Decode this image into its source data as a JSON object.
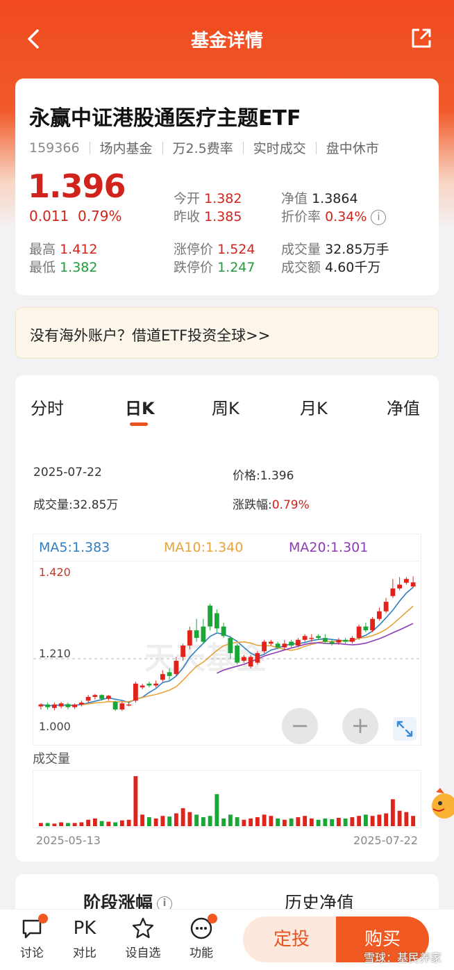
{
  "header": {
    "title": "基金详情"
  },
  "fund": {
    "name": "永赢中证港股通医疗主题ETF",
    "code": "159366",
    "tag1": "场内基金",
    "tag2": "万2.5费率",
    "tag3": "实时成交",
    "tag4": "盘中休市",
    "price": "1.396",
    "change": "0.011",
    "change_pct": "0.79%",
    "high_label": "最高",
    "high": "1.412",
    "low_label": "最低",
    "low": "1.382",
    "open_label": "今开",
    "open": "1.382",
    "prev_label": "昨收",
    "prev": "1.385",
    "limit_up_label": "涨停价",
    "limit_up": "1.524",
    "limit_down_label": "跌停价",
    "limit_down": "1.247",
    "nav_label": "净值",
    "nav": "1.3864",
    "discount_label": "折价率",
    "discount": "0.34%",
    "volume_label": "成交量",
    "volume": "32.85万手",
    "amount_label": "成交额",
    "amount": "4.60千万"
  },
  "banner": {
    "text": "没有海外账户？借道ETF投资全球>>"
  },
  "chart_tabs": [
    "分时",
    "日K",
    "周K",
    "月K",
    "净值"
  ],
  "active_tab": "日K",
  "point_info": {
    "date": "2025-07-22",
    "price_label": "价格:",
    "price": "1.396",
    "vol_label": "成交量:",
    "vol": "32.85万",
    "chg_label": "涨跌幅:",
    "chg": "0.79%"
  },
  "ma": {
    "ma5": "MA5:1.383",
    "ma10": "MA10:1.340",
    "ma20": "MA20:1.301"
  },
  "colors": {
    "ma5": "#2f7fc1",
    "ma10": "#e8a33a",
    "ma20": "#8e3bb5",
    "up": "#e0241c",
    "down": "#1aa737",
    "accent": "#f05a22"
  },
  "chart_data": {
    "type": "candlestick",
    "y_ticks": [
      "1.420",
      "1.210",
      "1.000"
    ],
    "ylim": [
      1.0,
      1.42
    ],
    "x_start": "2025-05-13",
    "x_end": "2025-07-22",
    "volume_label": "成交量",
    "candles": [
      [
        1.07,
        1.075,
        1.062,
        1.078
      ],
      [
        1.075,
        1.068,
        1.062,
        1.08
      ],
      [
        1.066,
        1.075,
        1.06,
        1.08
      ],
      [
        1.07,
        1.078,
        1.065,
        1.082
      ],
      [
        1.076,
        1.068,
        1.062,
        1.08
      ],
      [
        1.068,
        1.075,
        1.063,
        1.078
      ],
      [
        1.075,
        1.08,
        1.07,
        1.085
      ],
      [
        1.085,
        1.095,
        1.08,
        1.1
      ],
      [
        1.095,
        1.1,
        1.088,
        1.103
      ],
      [
        1.1,
        1.09,
        1.085,
        1.102
      ],
      [
        1.09,
        1.098,
        1.085,
        1.1
      ],
      [
        1.082,
        1.062,
        1.058,
        1.085
      ],
      [
        1.062,
        1.078,
        1.058,
        1.082
      ],
      [
        1.075,
        1.075,
        1.07,
        1.082
      ],
      [
        1.085,
        1.13,
        1.08,
        1.135
      ],
      [
        1.12,
        1.125,
        1.115,
        1.13
      ],
      [
        1.13,
        1.125,
        1.12,
        1.135
      ],
      [
        1.125,
        1.13,
        1.12,
        1.138
      ],
      [
        1.14,
        1.155,
        1.135,
        1.165
      ],
      [
        1.16,
        1.15,
        1.14,
        1.17
      ],
      [
        1.155,
        1.19,
        1.15,
        1.2
      ],
      [
        1.2,
        1.23,
        1.19,
        1.235
      ],
      [
        1.23,
        1.27,
        1.22,
        1.28
      ],
      [
        1.27,
        1.25,
        1.24,
        1.3
      ],
      [
        1.28,
        1.24,
        1.235,
        1.3
      ],
      [
        1.335,
        1.28,
        1.27,
        1.34
      ],
      [
        1.315,
        1.275,
        1.265,
        1.325
      ],
      [
        1.28,
        1.255,
        1.25,
        1.29
      ],
      [
        1.25,
        1.21,
        1.195,
        1.255
      ],
      [
        1.23,
        1.185,
        1.18,
        1.235
      ],
      [
        1.19,
        1.2,
        1.185,
        1.205
      ],
      [
        1.175,
        1.2,
        1.17,
        1.205
      ],
      [
        1.185,
        1.21,
        1.18,
        1.215
      ],
      [
        1.215,
        1.24,
        1.21,
        1.245
      ],
      [
        1.235,
        1.24,
        1.23,
        1.245
      ],
      [
        1.235,
        1.225,
        1.22,
        1.24
      ],
      [
        1.225,
        1.235,
        1.22,
        1.245
      ],
      [
        1.24,
        1.23,
        1.225,
        1.245
      ],
      [
        1.23,
        1.245,
        1.225,
        1.25
      ],
      [
        1.245,
        1.255,
        1.24,
        1.26
      ],
      [
        1.25,
        1.25,
        1.24,
        1.26
      ],
      [
        1.255,
        1.25,
        1.245,
        1.26
      ],
      [
        1.25,
        1.24,
        1.235,
        1.26
      ],
      [
        1.24,
        1.235,
        1.23,
        1.245
      ],
      [
        1.238,
        1.245,
        1.232,
        1.25
      ],
      [
        1.245,
        1.24,
        1.235,
        1.25
      ],
      [
        1.24,
        1.25,
        1.235,
        1.255
      ],
      [
        1.25,
        1.28,
        1.245,
        1.285
      ],
      [
        1.28,
        1.27,
        1.265,
        1.29
      ],
      [
        1.27,
        1.3,
        1.265,
        1.305
      ],
      [
        1.3,
        1.32,
        1.295,
        1.33
      ],
      [
        1.32,
        1.345,
        1.315,
        1.355
      ],
      [
        1.36,
        1.38,
        1.355,
        1.405
      ],
      [
        1.38,
        1.39,
        1.375,
        1.41
      ],
      [
        1.395,
        1.405,
        1.39,
        1.41
      ],
      [
        1.385,
        1.396,
        1.382,
        1.412
      ]
    ],
    "volumes": [
      5,
      5,
      4,
      6,
      5,
      5,
      6,
      10,
      12,
      8,
      7,
      6,
      9,
      10,
      78,
      18,
      14,
      12,
      16,
      15,
      20,
      28,
      22,
      18,
      14,
      16,
      50,
      12,
      18,
      14,
      10,
      12,
      14,
      18,
      16,
      12,
      10,
      12,
      14,
      16,
      12,
      10,
      12,
      11,
      13,
      12,
      14,
      16,
      18,
      16,
      18,
      20,
      42,
      24,
      22,
      16
    ]
  },
  "stage": {
    "tab1": "阶段涨幅",
    "tab2": "历史净值"
  },
  "bottom": {
    "discuss": "讨论",
    "compare_icon": "PK",
    "compare": "对比",
    "watch": "设自选",
    "func": "功能",
    "dingtou": "定投",
    "buy": "购买",
    "watermark": "雪球：基民养家"
  },
  "chart_watermark": "天天基金"
}
